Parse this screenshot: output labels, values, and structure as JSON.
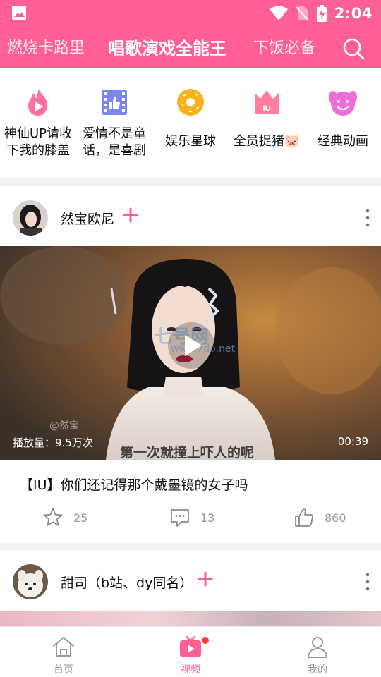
{
  "status_bar": {
    "time": "2:04"
  },
  "header": {
    "tabs": [
      {
        "label": "燃烧卡路里"
      },
      {
        "label": "唱歌演戏全能王"
      },
      {
        "label": "下饭必备"
      }
    ]
  },
  "categories": [
    {
      "label": "神仙UP请收下我的膝盖",
      "line1": "神仙UP请收",
      "line2": "下我的膝盖",
      "icon": "flame-play-icon",
      "color": "#ff6fa0"
    },
    {
      "label": "爱情不是童话，是喜剧",
      "line1": "爱情不是童",
      "line2": "话，是喜剧",
      "icon": "film-like-icon",
      "color": "#7b86f2"
    },
    {
      "label": "娱乐星球",
      "icon": "donut-icon",
      "color": "#f7b21c"
    },
    {
      "label": "全员捉猪🐷",
      "icon": "crown-box-icon",
      "color": "#ff7f9d"
    },
    {
      "label": "经典动画",
      "icon": "cartoon-face-icon",
      "color": "#f06dd6"
    }
  ],
  "feed": [
    {
      "author": "然宝欧尼",
      "plays": "播放量：9.5万次",
      "duration": "00:39",
      "video_subtitle": "第一次就撞上吓人的呢",
      "watermark": "七号网",
      "watermark_url": "www.7do.net",
      "credit": "@然宝",
      "title": "【IU】你们还记得那个戴墨镜的女子吗",
      "stats": {
        "favorites": "25",
        "comments": "13",
        "likes": "860"
      }
    },
    {
      "author": "甜司（b站、dy同名）"
    }
  ],
  "bottom_nav": [
    {
      "label": "首页"
    },
    {
      "label": "视频"
    },
    {
      "label": "我的"
    }
  ],
  "colors": {
    "brand": "#ff5f93",
    "muted": "#999999"
  }
}
